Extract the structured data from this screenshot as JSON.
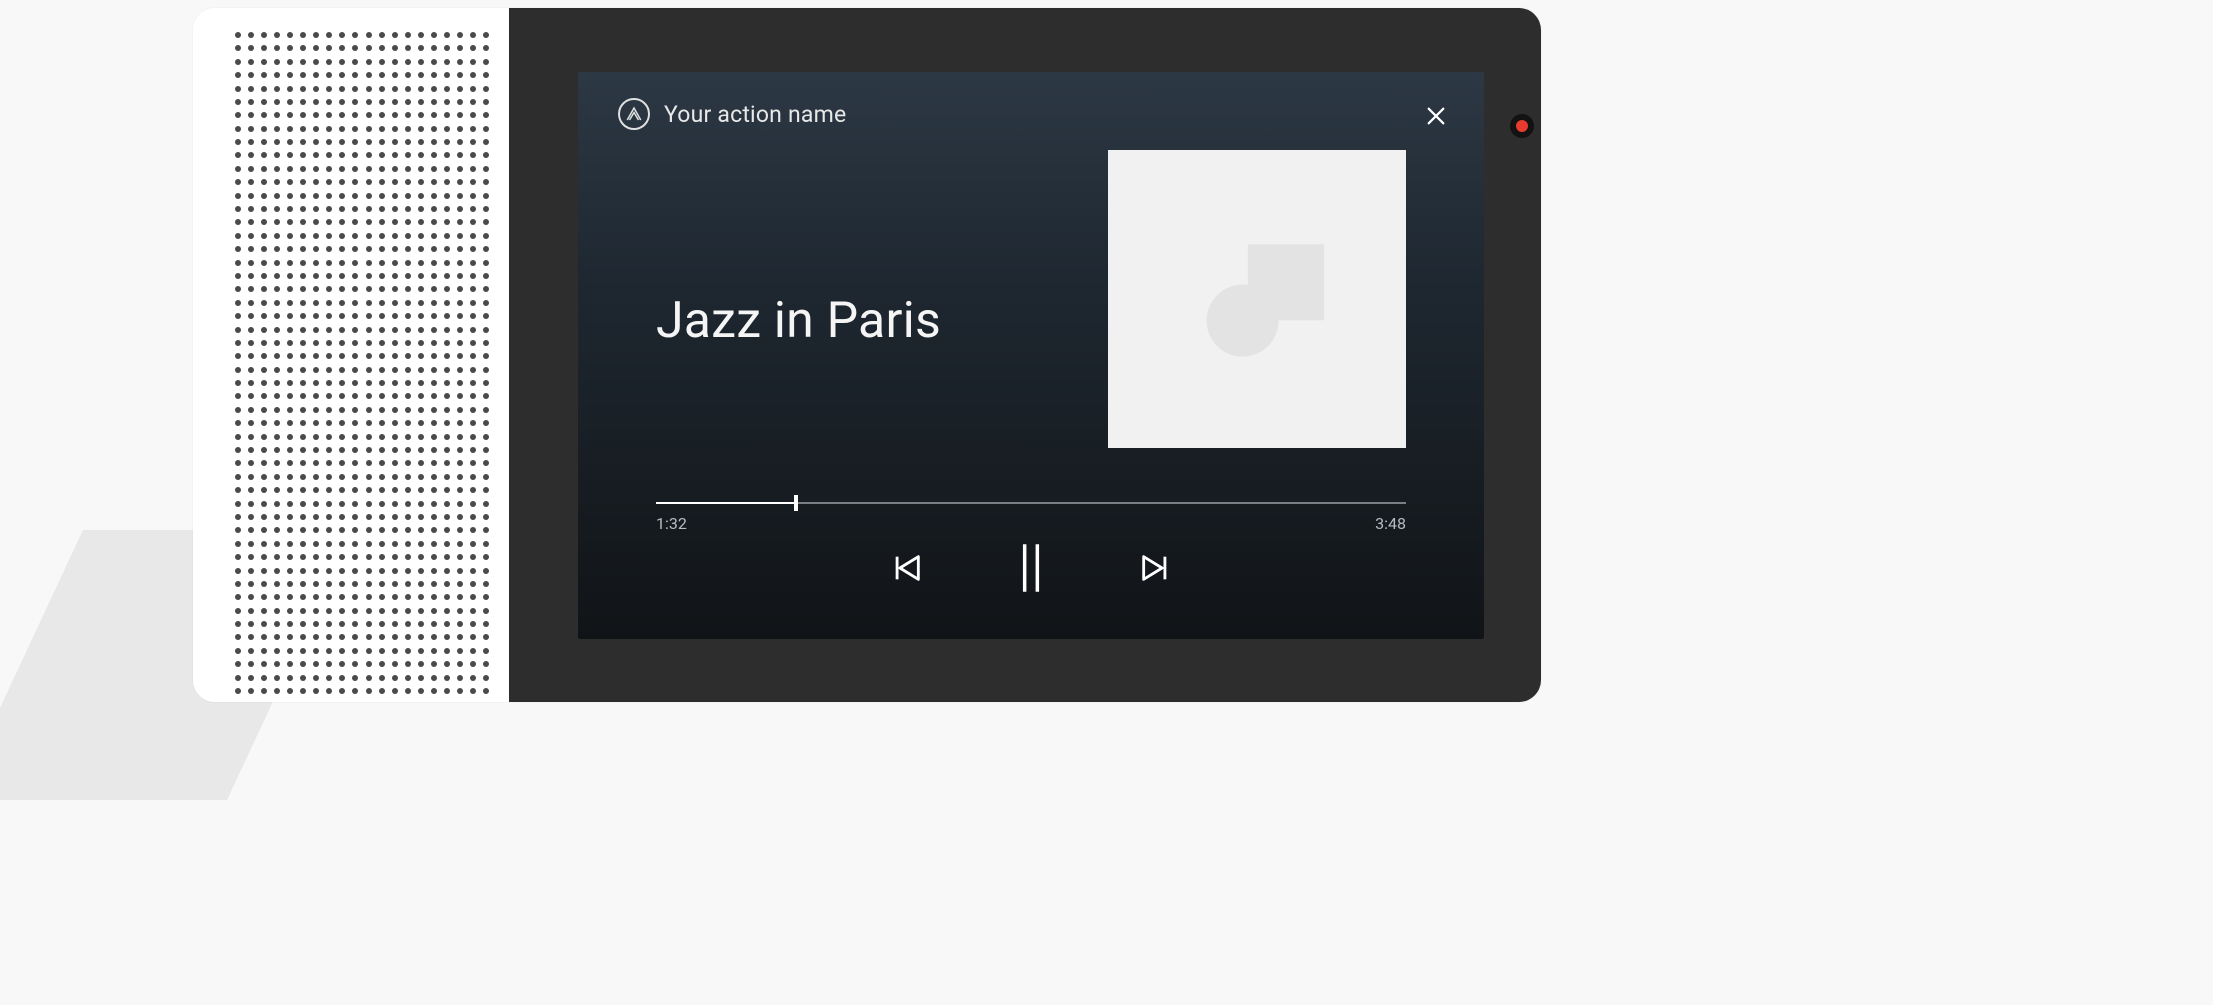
{
  "header": {
    "action_name": "Your action name"
  },
  "media": {
    "track_title": "Jazz in Paris",
    "elapsed": "1:32",
    "duration": "3:48",
    "progress_percent": 18.7
  },
  "icons": {
    "logo": "action-logo-icon",
    "close": "close-icon",
    "prev": "skip-previous-icon",
    "pause": "pause-icon",
    "next": "skip-next-icon",
    "album_placeholder": "album-placeholder-icon",
    "record": "record-indicator-icon"
  }
}
